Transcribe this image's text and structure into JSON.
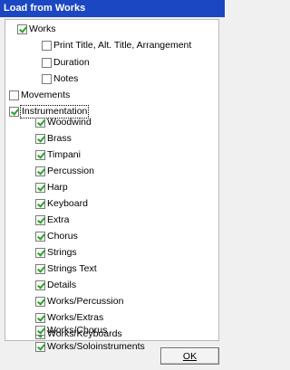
{
  "window": {
    "title": "Load from Works"
  },
  "tree": {
    "items": [
      {
        "label": "Works",
        "checked": true
      },
      {
        "label": "Print Title, Alt. Title, Arrangement",
        "checked": false
      },
      {
        "label": "Duration",
        "checked": false
      },
      {
        "label": "Notes",
        "checked": false
      },
      {
        "label": "Movements",
        "checked": false
      },
      {
        "label": "Instrumentation",
        "checked": true,
        "focused": true
      },
      {
        "label": "Woodwind",
        "checked": true
      },
      {
        "label": "Brass",
        "checked": true
      },
      {
        "label": "Timpani",
        "checked": true
      },
      {
        "label": "Percussion",
        "checked": true
      },
      {
        "label": "Harp",
        "checked": true
      },
      {
        "label": "Keyboard",
        "checked": true
      },
      {
        "label": "Extra",
        "checked": true
      },
      {
        "label": "Chorus",
        "checked": true
      },
      {
        "label": "Strings",
        "checked": true
      },
      {
        "label": "Strings Text",
        "checked": true
      },
      {
        "label": "Details",
        "checked": true
      },
      {
        "label": "Works/Percussion",
        "checked": true
      },
      {
        "label": "Works/Extras",
        "checked": true
      },
      {
        "label": "Works/Keyboards",
        "checked": true
      },
      {
        "label": "Works/Chorus",
        "checked": true
      },
      {
        "label": "Works/Soloinstruments",
        "checked": true
      }
    ]
  },
  "buttons": {
    "ok_label": "OK"
  },
  "colors": {
    "titlebar": "#1b47c2",
    "checkmark": "#2aa12a",
    "background": "#f0f0f0"
  }
}
